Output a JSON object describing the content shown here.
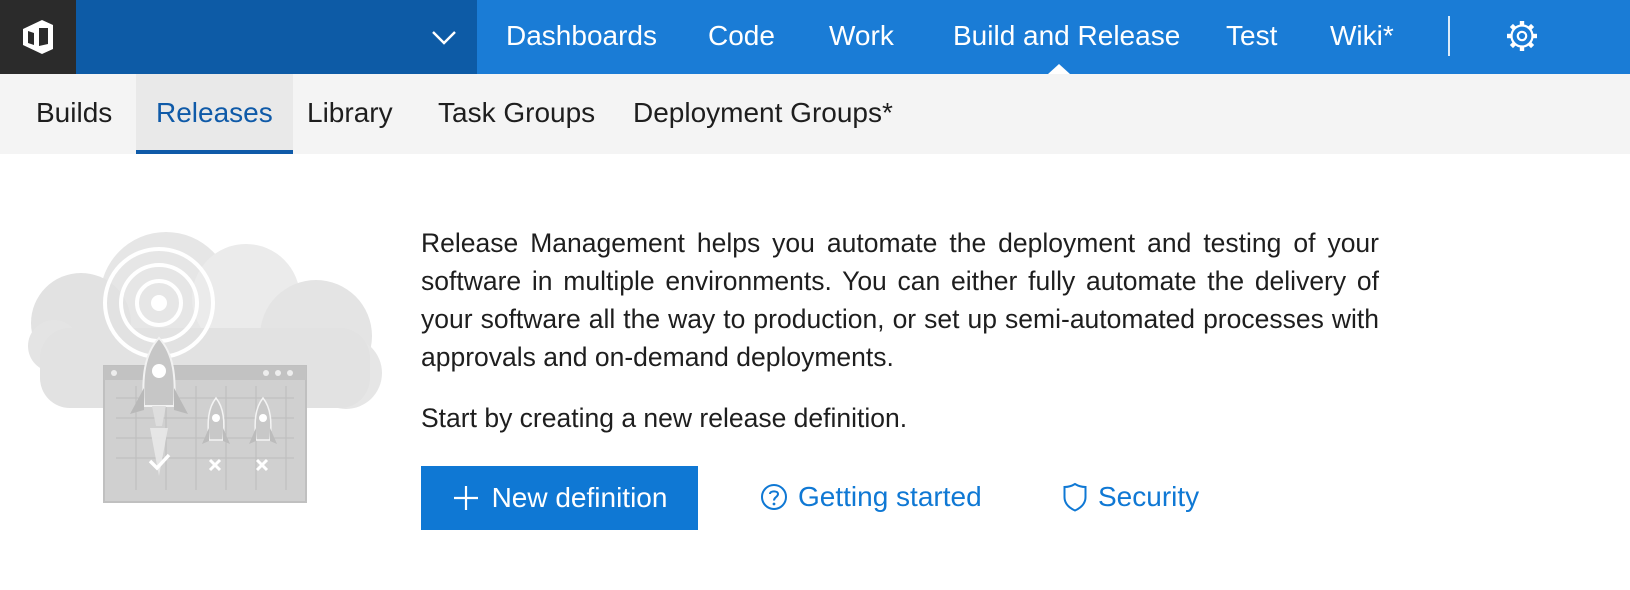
{
  "colors": {
    "brand_blue": "#1a7cd6",
    "project_blue": "#0d5ba6",
    "logo_dark": "#2b2b2b",
    "active_tab": "#0f5aa8",
    "button_blue": "#0f78d4",
    "link_blue": "#0f78d4"
  },
  "header": {
    "logo_icon": "visual-studio-team-services-icon",
    "project_dropdown_icon": "chevron-down-icon",
    "nav": [
      {
        "label": "Dashboards"
      },
      {
        "label": "Code"
      },
      {
        "label": "Work"
      },
      {
        "label": "Build and Release",
        "active": true
      },
      {
        "label": "Test"
      },
      {
        "label": "Wiki*"
      }
    ],
    "settings_icon": "gear-icon"
  },
  "subnav": {
    "tabs": [
      {
        "label": "Builds"
      },
      {
        "label": "Releases",
        "active": true
      },
      {
        "label": "Library"
      },
      {
        "label": "Task Groups"
      },
      {
        "label": "Deployment Groups*"
      }
    ]
  },
  "main": {
    "illustration_icon": "rocket-launch-illustration",
    "description": "Release Management helps you automate the deployment and testing of your software in multiple environments. You can either fully automate the delivery of your software all the way to production, or set up semi-automated processes with approvals and on-demand deployments.",
    "start_text": "Start by creating a new release definition.",
    "new_definition_label": "New definition",
    "new_definition_icon": "plus-icon",
    "getting_started_label": "Getting started",
    "getting_started_icon": "help-circle-icon",
    "security_label": "Security",
    "security_icon": "shield-icon"
  }
}
